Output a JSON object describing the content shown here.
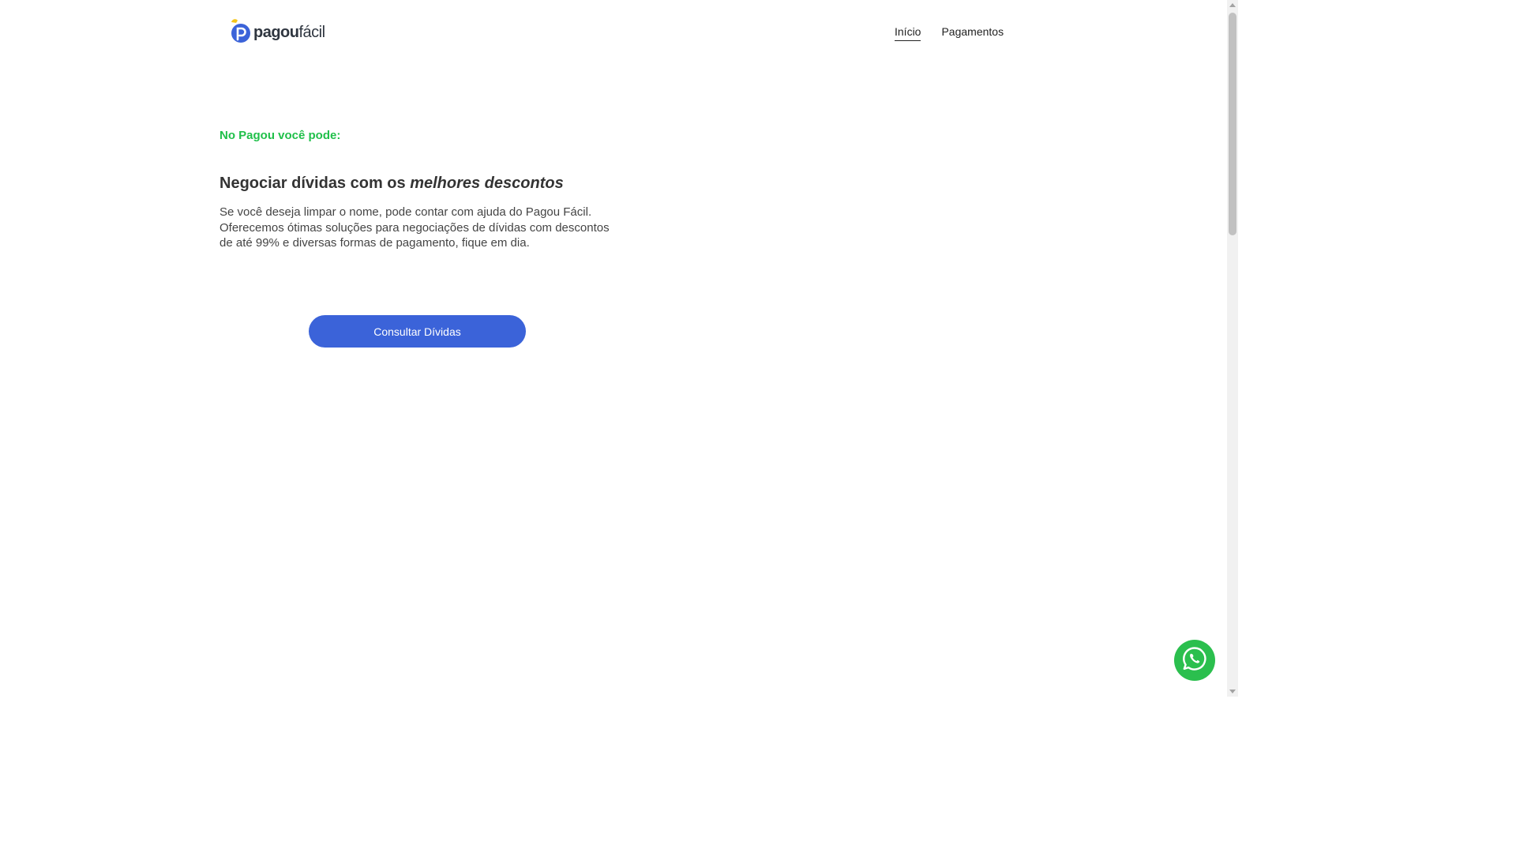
{
  "brand": {
    "name_part1": "pagou",
    "name_part2": "fácil",
    "colors": {
      "mark_blue": "#3b63d9",
      "mark_yellow": "#f5c518",
      "text": "#2f3640"
    }
  },
  "nav": {
    "items": [
      {
        "label": "Início",
        "active": true
      },
      {
        "label": "Pagamentos",
        "active": false
      }
    ]
  },
  "hero": {
    "eyebrow": "No Pagou você pode:",
    "headline_plain": "Negociar dívidas com os ",
    "headline_emphasis": "melhores descontos",
    "body": "Se você deseja limpar o nome, pode contar com ajuda do Pagou Fácil. Oferecemos ótimas soluções para negociações de dívidas com descontos de até 99% e diversas formas de pagamento, fique em dia.",
    "cta_label": "Consultar Dívidas"
  },
  "floating": {
    "whatsapp_icon": "whatsapp-icon"
  },
  "colors": {
    "accent_green": "#20c04a",
    "button_blue": "#3b63d9",
    "whatsapp_green": "#2bbf4e"
  }
}
